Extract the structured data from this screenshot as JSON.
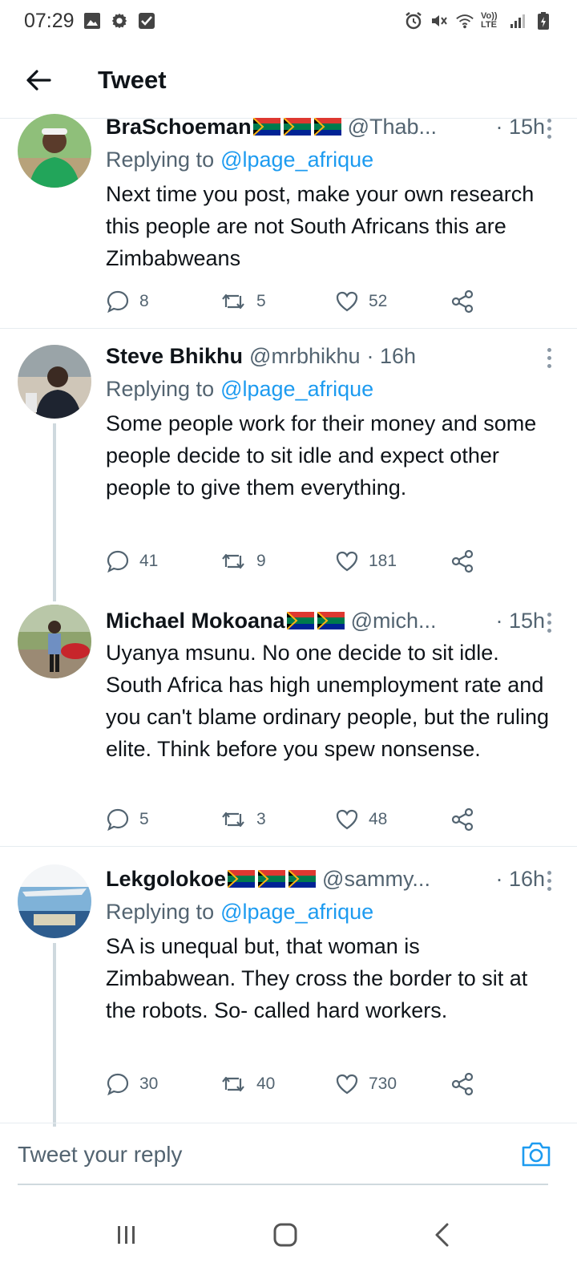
{
  "status_bar": {
    "time": "07:29",
    "left_icons": [
      "image-icon",
      "gear-icon",
      "check-box-icon"
    ],
    "right_icons": [
      "alarm-icon",
      "mute-icon",
      "wifi-icon",
      "volte-icon",
      "signal-icon",
      "battery-icon"
    ],
    "volte_text": "Vo)) LTE"
  },
  "header": {
    "title": "Tweet"
  },
  "tweets": [
    {
      "name": "BraSchoeman",
      "flags": 3,
      "handle": "@Thab...",
      "time": "· 15h",
      "replying_label": "Replying to",
      "replying_to": "@lpage_afrique",
      "text": "Next time you post, make your own research this people are not South Africans this are Zimbabweans",
      "replies": "8",
      "retweets": "5",
      "likes": "52"
    },
    {
      "name": "Steve Bhikhu",
      "flags": 0,
      "handle": "@mrbhikhu",
      "time": "· 16h",
      "replying_label": "Replying to",
      "replying_to": "@lpage_afrique",
      "text": "Some people work for their money and some people decide to sit idle and expect other people to give them everything.",
      "replies": "41",
      "retweets": "9",
      "likes": "181"
    },
    {
      "name": "Michael Mokoana",
      "flags": 2,
      "handle": "@mich...",
      "time": "· 15h",
      "text": "Uyanya msunu. No one decide to sit idle. South Africa has high unemployment rate and you can't blame ordinary people, but the ruling elite. Think before you spew nonsense.",
      "replies": "5",
      "retweets": "3",
      "likes": "48"
    },
    {
      "name": "Lekgolokoe",
      "flags": 3,
      "handle": "@sammy...",
      "time": "· 16h",
      "replying_label": "Replying to",
      "replying_to": "@lpage_afrique",
      "text": "SA is unequal but, that woman is Zimbabwean. They cross the border to sit at the robots. So- called hard workers.",
      "replies": "30",
      "retweets": "40",
      "likes": "730"
    }
  ],
  "reply_box": {
    "placeholder": "Tweet your reply"
  },
  "nav": {
    "icons": [
      "recent-apps-icon",
      "home-icon",
      "back-icon"
    ]
  },
  "colors": {
    "accent": "#1d9bf0",
    "muted": "#536471",
    "text": "#0f1419",
    "border": "#e6ecf0"
  }
}
